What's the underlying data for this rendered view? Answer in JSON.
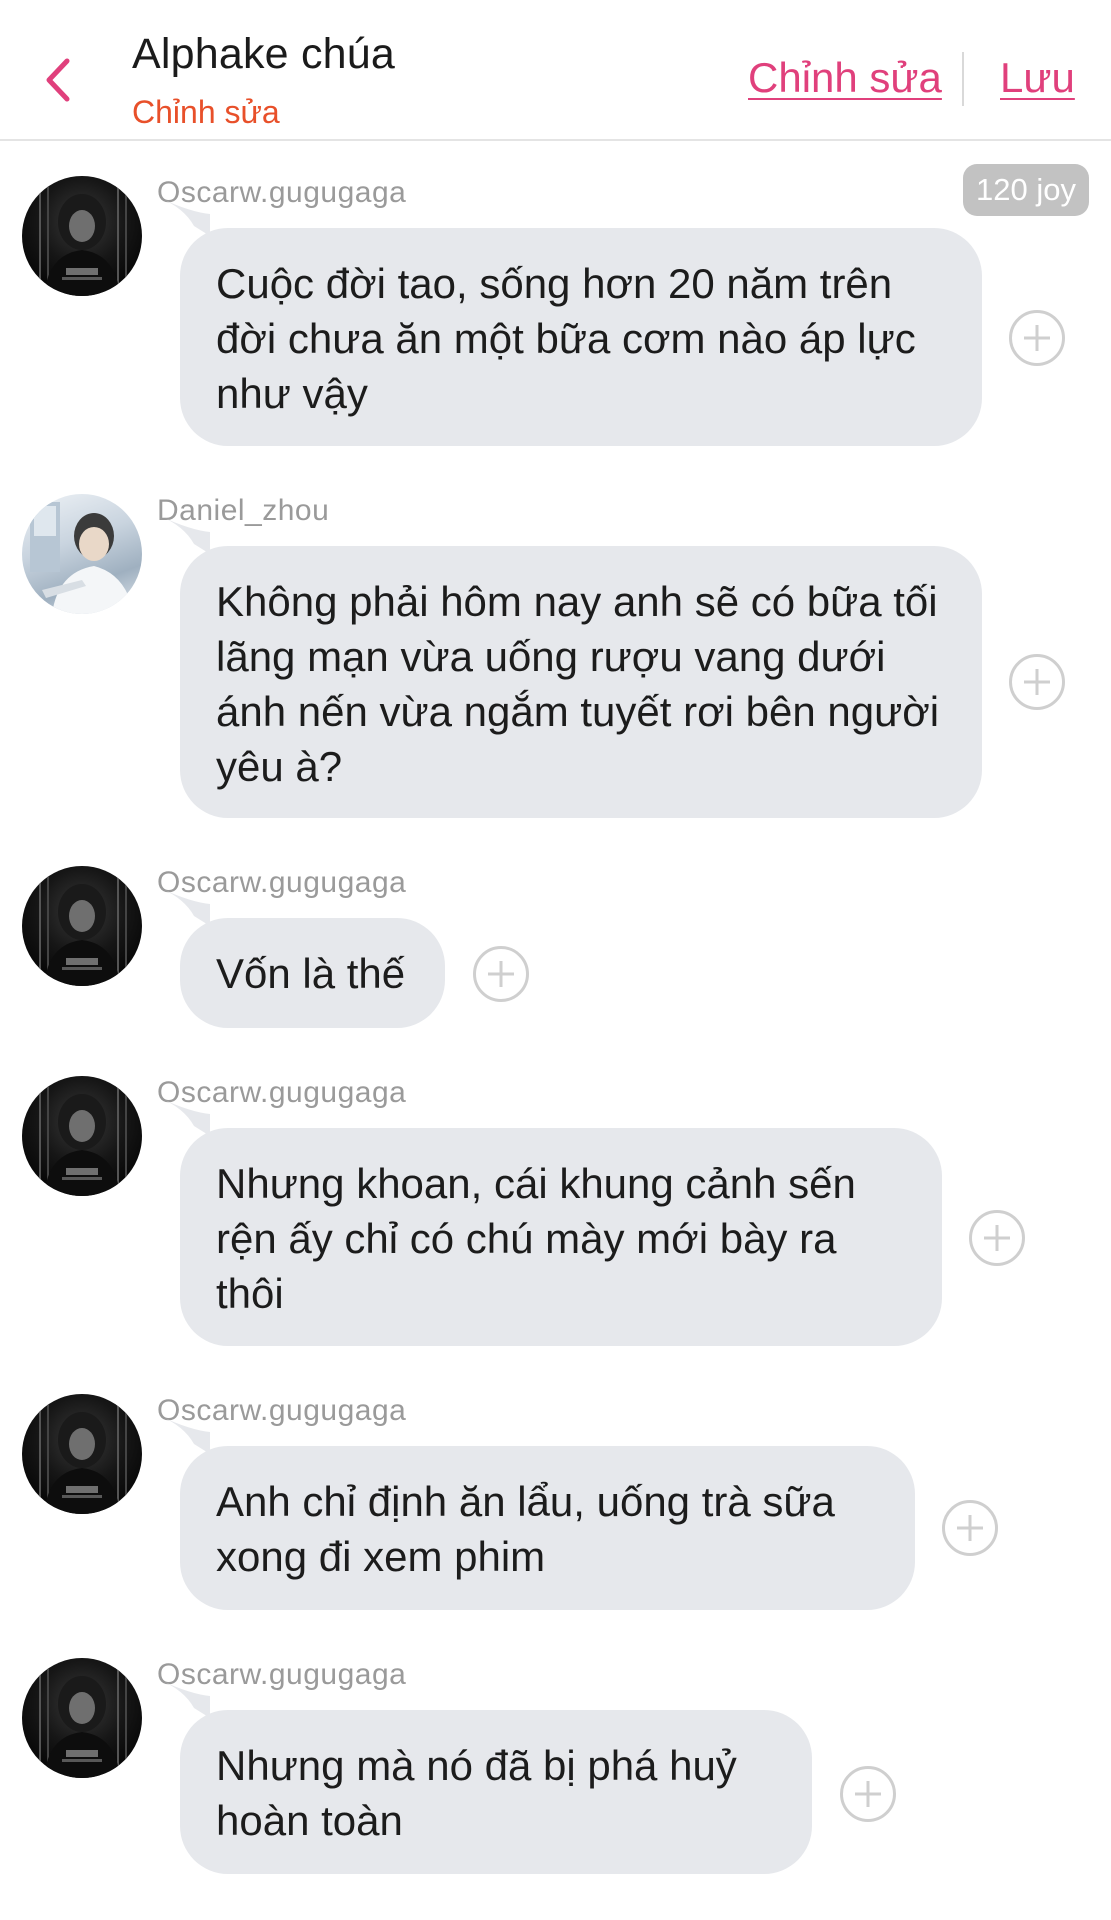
{
  "header": {
    "title": "Alphake chúa",
    "subtitle": "Chỉnh sửa",
    "edit_label": "Chỉnh sửa",
    "save_label": "Lưu",
    "accent_color": "#e0407c",
    "subtitle_color": "#e8502a"
  },
  "joy_badge": "120 joy",
  "messages": [
    {
      "username": "Oscarw.gugugaga",
      "avatar": "dark-hoodie-avatar",
      "text": "Cuộc đời tao, sống hơn 20 năm trên đời chưa ăn một bữa cơm nào áp lực như vậy"
    },
    {
      "username": "Daniel_zhou",
      "avatar": "light-portrait-avatar",
      "text": "Không phải hôm nay anh sẽ có bữa tối lãng mạn vừa uống rượu vang dưới ánh nến vừa ngắm tuyết rơi bên người yêu à?"
    },
    {
      "username": "Oscarw.gugugaga",
      "avatar": "dark-hoodie-avatar",
      "text": "Vốn là thế"
    },
    {
      "username": "Oscarw.gugugaga",
      "avatar": "dark-hoodie-avatar",
      "text": "Nhưng khoan, cái khung cảnh sến rện ấy chỉ có chú mày mới bày ra thôi"
    },
    {
      "username": "Oscarw.gugugaga",
      "avatar": "dark-hoodie-avatar",
      "text": "Anh chỉ định ăn lẩu, uống trà sữa xong đi xem phim"
    },
    {
      "username": "Oscarw.gugugaga",
      "avatar": "dark-hoodie-avatar",
      "text": "Nhưng mà nó đã bị phá huỷ hoàn toàn"
    }
  ],
  "icons": {
    "back": "chevron-left-icon",
    "add_reaction": "plus-circle-icon"
  },
  "colors": {
    "bubble": "#e6e8ec",
    "username": "#9a9a9a",
    "badge": "#c2c2c2"
  }
}
